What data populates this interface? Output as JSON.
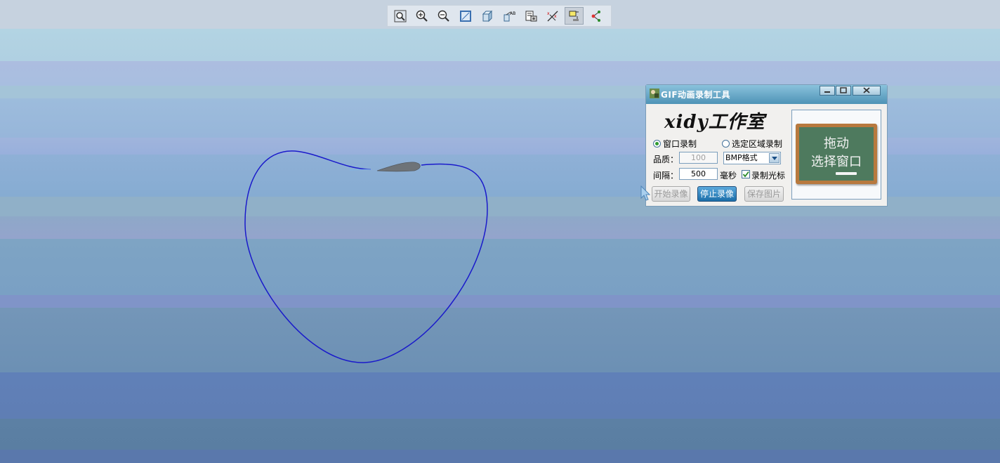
{
  "toolbar": {
    "icons": [
      "zoom-fit-icon",
      "zoom-in-icon",
      "zoom-out-icon",
      "view-area-icon",
      "display-style-icon",
      "annotation-icon",
      "saved-views-icon",
      "datum-display-icon",
      "layer-icon",
      "spin-center-icon"
    ]
  },
  "dialog": {
    "title": "GIF动画录制工具",
    "brand": "xidy工作室",
    "radio_window": "窗口录制",
    "radio_region": "选定区域录制",
    "quality_label": "品质：",
    "quality_value": "100",
    "format_value": "BMP格式",
    "interval_label": "间隔：",
    "interval_value": "500",
    "interval_unit": "毫秒",
    "record_cursor_label": "录制光标",
    "start_button": "开始录像",
    "stop_button": "停止录像",
    "save_button": "保存图片",
    "preview_line1": "拖动",
    "preview_line2": "选择窗口"
  },
  "colors": {
    "curve": "#1a1acb",
    "accent_blue": "#1b6ea9",
    "titlebar": "#4e93b6"
  }
}
